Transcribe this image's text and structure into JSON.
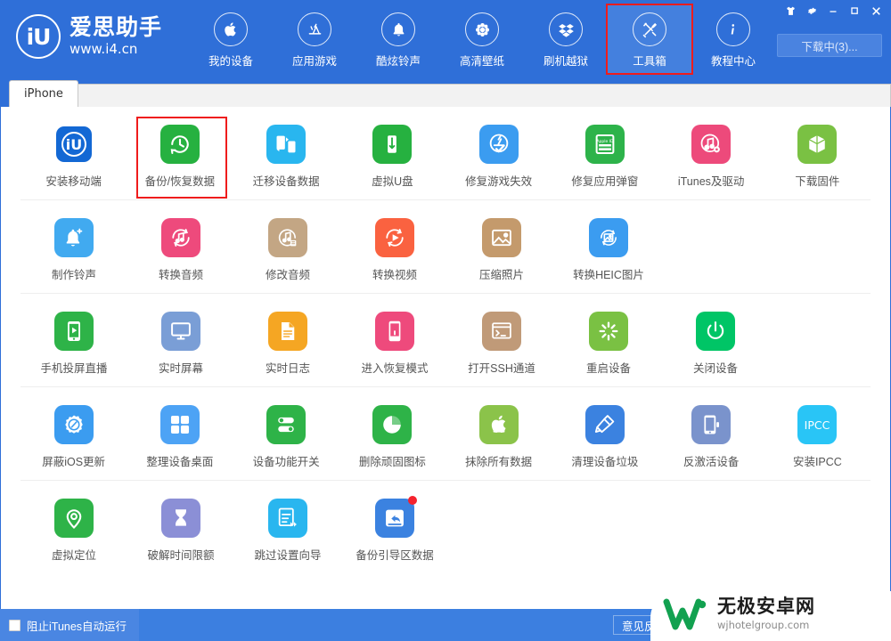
{
  "brand": {
    "logo_text": "iU",
    "name": "爱思助手",
    "url": "www.i4.cn"
  },
  "header": {
    "nav": [
      {
        "label": "我的设备",
        "icon": "apple-icon",
        "active": false
      },
      {
        "label": "应用游戏",
        "icon": "appstore-icon",
        "active": false
      },
      {
        "label": "酷炫铃声",
        "icon": "bell-icon",
        "active": false
      },
      {
        "label": "高清壁纸",
        "icon": "flower-icon",
        "active": false
      },
      {
        "label": "刷机越狱",
        "icon": "dropbox-icon",
        "active": false
      },
      {
        "label": "工具箱",
        "icon": "tools-icon",
        "active": true
      },
      {
        "label": "教程中心",
        "icon": "info-icon",
        "active": false
      }
    ],
    "window_controls": [
      {
        "name": "skin-button",
        "glyph": "shirt-icon"
      },
      {
        "name": "settings-button",
        "glyph": "gear-icon"
      },
      {
        "name": "minimize-button",
        "glyph": "minimize-icon"
      },
      {
        "name": "maximize-button",
        "glyph": "maximize-icon"
      },
      {
        "name": "close-button",
        "glyph": "close-icon"
      }
    ],
    "download_button": "下载中(3)..."
  },
  "tabs": [
    {
      "label": "iPhone",
      "active": true
    }
  ],
  "toolbox": {
    "rows": [
      {
        "tools": [
          {
            "label": "安装移动端",
            "icon": "i4-app-icon",
            "bg": "#ffffff",
            "accent": "#1368d4",
            "badge": false,
            "highlight": false
          },
          {
            "label": "备份/恢复数据",
            "icon": "backup-restore-icon",
            "bg": "#26b140",
            "accent": "#ffffff",
            "badge": false,
            "highlight": true
          },
          {
            "label": "迁移设备数据",
            "icon": "migrate-data-icon",
            "bg": "#29b6ef",
            "accent": "#ffffff",
            "badge": false,
            "highlight": false
          },
          {
            "label": "虚拟U盘",
            "icon": "usb-disk-icon",
            "bg": "#26b140",
            "accent": "#ffffff",
            "badge": false,
            "highlight": false
          },
          {
            "label": "修复游戏失效",
            "icon": "fix-game-icon",
            "bg": "#3b9cf0",
            "accent": "#ffffff",
            "badge": false,
            "highlight": false
          },
          {
            "label": "修复应用弹窗",
            "icon": "appleid-popup-icon",
            "bg": "#2db34a",
            "accent": "#ffffff",
            "badge": false,
            "highlight": false
          },
          {
            "label": "iTunes及驱动",
            "icon": "itunes-driver-icon",
            "bg": "#ed4a7b",
            "accent": "#ffffff",
            "badge": false,
            "highlight": false
          },
          {
            "label": "下载固件",
            "icon": "firmware-box-icon",
            "bg": "#7ac143",
            "accent": "#ffffff",
            "badge": false,
            "highlight": false
          }
        ]
      },
      {
        "tools": [
          {
            "label": "制作铃声",
            "icon": "make-ringtone-icon",
            "bg": "#41aaf0",
            "accent": "#ffffff",
            "badge": false,
            "highlight": false
          },
          {
            "label": "转换音频",
            "icon": "convert-audio-icon",
            "bg": "#ee4a7c",
            "accent": "#ffffff",
            "badge": false,
            "highlight": false
          },
          {
            "label": "修改音频",
            "icon": "edit-audio-icon",
            "bg": "#c3a684",
            "accent": "#ffffff",
            "badge": false,
            "highlight": false
          },
          {
            "label": "转换视频",
            "icon": "convert-video-icon",
            "bg": "#fa6240",
            "accent": "#ffffff",
            "badge": false,
            "highlight": false
          },
          {
            "label": "压缩照片",
            "icon": "compress-photo-icon",
            "bg": "#c49a6c",
            "accent": "#ffffff",
            "badge": false,
            "highlight": false
          },
          {
            "label": "转换HEIC图片",
            "icon": "convert-heic-icon",
            "bg": "#3b9cf0",
            "accent": "#ffffff",
            "badge": false,
            "highlight": false
          }
        ]
      },
      {
        "tools": [
          {
            "label": "手机投屏直播",
            "icon": "screen-cast-icon",
            "bg": "#2eb348",
            "accent": "#ffffff",
            "badge": false,
            "highlight": false
          },
          {
            "label": "实时屏幕",
            "icon": "realtime-screen-icon",
            "bg": "#7a9ed6",
            "accent": "#ffffff",
            "badge": false,
            "highlight": false
          },
          {
            "label": "实时日志",
            "icon": "realtime-log-icon",
            "bg": "#f5a623",
            "accent": "#ffffff",
            "badge": false,
            "highlight": false
          },
          {
            "label": "进入恢复模式",
            "icon": "recovery-mode-icon",
            "bg": "#ee4a7c",
            "accent": "#ffffff",
            "badge": false,
            "highlight": false
          },
          {
            "label": "打开SSH通道",
            "icon": "ssh-tunnel-icon",
            "bg": "#c09a78",
            "accent": "#ffffff",
            "badge": false,
            "highlight": false
          },
          {
            "label": "重启设备",
            "icon": "reboot-device-icon",
            "bg": "#7ac143",
            "accent": "#ffffff",
            "badge": false,
            "highlight": false
          },
          {
            "label": "关闭设备",
            "icon": "power-off-icon",
            "bg": "#00c566",
            "accent": "#ffffff",
            "badge": false,
            "highlight": false
          }
        ]
      },
      {
        "tools": [
          {
            "label": "屏蔽iOS更新",
            "icon": "block-ios-update-icon",
            "bg": "#3b9cf0",
            "accent": "#ffffff",
            "badge": false,
            "highlight": false
          },
          {
            "label": "整理设备桌面",
            "icon": "organize-desktop-icon",
            "bg": "#4da3f5",
            "accent": "#ffffff",
            "badge": false,
            "highlight": false
          },
          {
            "label": "设备功能开关",
            "icon": "feature-toggle-icon",
            "bg": "#2eb348",
            "accent": "#ffffff",
            "badge": false,
            "highlight": false
          },
          {
            "label": "删除顽固图标",
            "icon": "delete-icon-icon",
            "bg": "#2eb348",
            "accent": "#ffffff",
            "badge": false,
            "highlight": false
          },
          {
            "label": "抹除所有数据",
            "icon": "erase-all-icon",
            "bg": "#8bc34a",
            "accent": "#ffffff",
            "badge": false,
            "highlight": false
          },
          {
            "label": "清理设备垃圾",
            "icon": "clean-junk-icon",
            "bg": "#3b82e0",
            "accent": "#ffffff",
            "badge": false,
            "highlight": false
          },
          {
            "label": "反激活设备",
            "icon": "deactivate-device-icon",
            "bg": "#7a93cc",
            "accent": "#ffffff",
            "badge": false,
            "highlight": false
          },
          {
            "label": "安装IPCC",
            "icon": "install-ipcc-icon",
            "bg": "#29c5f6",
            "accent": "#ffffff",
            "badge": false,
            "highlight": false
          }
        ]
      },
      {
        "tools": [
          {
            "label": "虚拟定位",
            "icon": "virtual-location-icon",
            "bg": "#2eb348",
            "accent": "#ffffff",
            "badge": false,
            "highlight": false
          },
          {
            "label": "破解时间限额",
            "icon": "hourglass-icon",
            "bg": "#8b8fd6",
            "accent": "#ffffff",
            "badge": false,
            "highlight": false
          },
          {
            "label": "跳过设置向导",
            "icon": "skip-setup-icon",
            "bg": "#29b6ef",
            "accent": "#ffffff",
            "badge": false,
            "highlight": false
          },
          {
            "label": "备份引导区数据",
            "icon": "backup-boot-icon",
            "bg": "#3b82e0",
            "accent": "#ffffff",
            "badge": true,
            "highlight": false
          }
        ]
      }
    ]
  },
  "footer": {
    "block_itunes_label": "阻止iTunes自动运行",
    "block_itunes_checked": false,
    "feedback_label": "意见反馈"
  },
  "watermark": {
    "title": "无极安卓网",
    "subtitle": "wjhotelgroup.com"
  },
  "colors": {
    "header_blue": "#2f6fd8",
    "active_blue": "#4480de",
    "highlight_red": "#ef1c1c",
    "footer_blue": "#3c7fe0"
  }
}
